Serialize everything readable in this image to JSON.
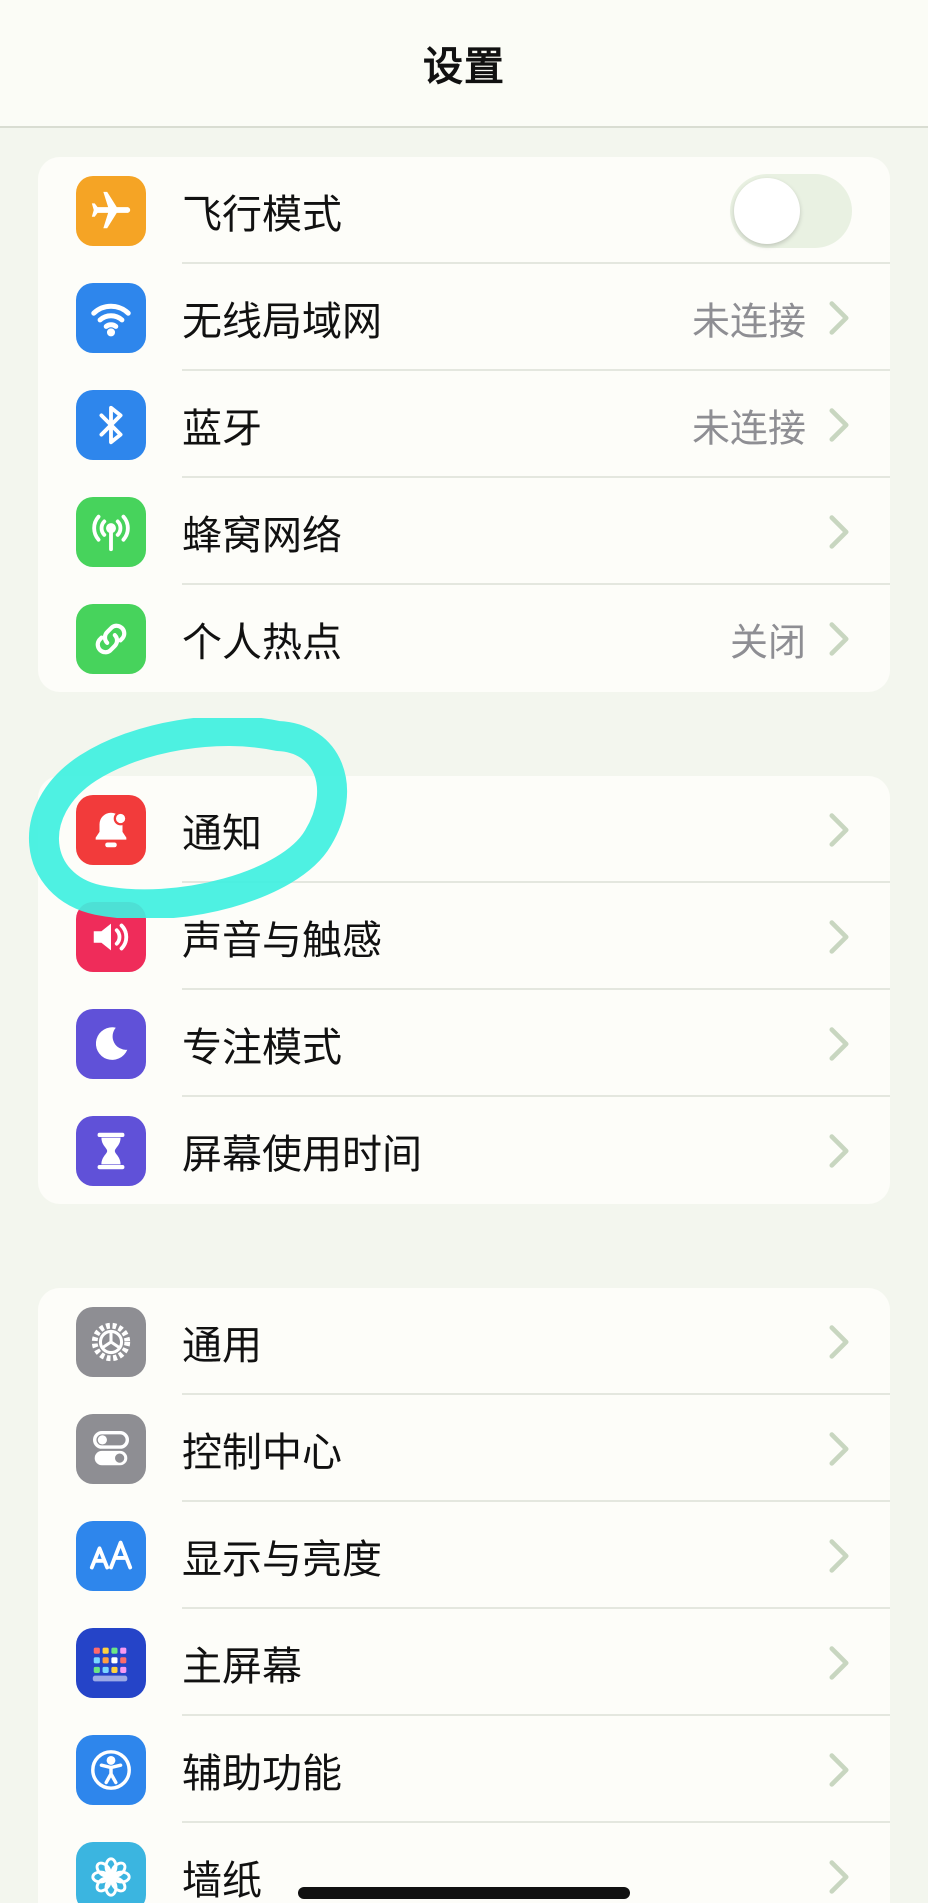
{
  "nav": {
    "title": "设置"
  },
  "group1": [
    {
      "label": "飞行模式",
      "icon": "airplane-icon",
      "color": "#f5a425",
      "control": "toggle",
      "toggle_on": false
    },
    {
      "label": "无线局域网",
      "icon": "wifi-icon",
      "color": "#2e86ec",
      "value": "未连接"
    },
    {
      "label": "蓝牙",
      "icon": "bluetooth-icon",
      "color": "#2e86ec",
      "value": "未连接"
    },
    {
      "label": "蜂窝网络",
      "icon": "antenna-icon",
      "color": "#47d35c"
    },
    {
      "label": "个人热点",
      "icon": "link-chain-icon",
      "color": "#47d35c",
      "value": "关闭"
    }
  ],
  "group2": [
    {
      "label": "通知",
      "icon": "bell-icon",
      "color": "#f23b3b"
    },
    {
      "label": "声音与触感",
      "icon": "speaker-icon",
      "color": "#ef2c5a"
    },
    {
      "label": "专注模式",
      "icon": "moon-icon",
      "color": "#6051d8"
    },
    {
      "label": "屏幕使用时间",
      "icon": "hourglass-icon",
      "color": "#6051d8"
    }
  ],
  "group3": [
    {
      "label": "通用",
      "icon": "gear-icon",
      "color": "#8e8e93"
    },
    {
      "label": "控制中心",
      "icon": "switches-icon",
      "color": "#8e8e93"
    },
    {
      "label": "显示与亮度",
      "icon": "text-size-icon",
      "color": "#2e86ec"
    },
    {
      "label": "主屏幕",
      "icon": "app-grid-icon",
      "color": "#2544c8"
    },
    {
      "label": "辅助功能",
      "icon": "accessibility-icon",
      "color": "#2e86ec"
    },
    {
      "label": "墙纸",
      "icon": "flower-icon",
      "color": "#3bb5e0"
    }
  ],
  "colors": {
    "highlight": "#3ff0e0",
    "chevron": "#c8d6c0"
  }
}
